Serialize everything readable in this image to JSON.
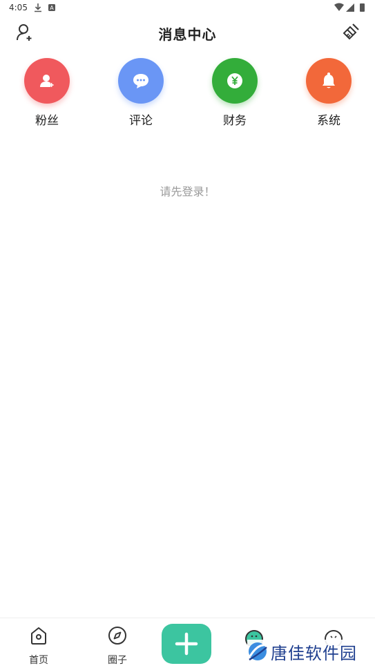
{
  "status_bar": {
    "time": "4:05"
  },
  "header": {
    "title": "消息中心"
  },
  "categories": [
    {
      "label": "粉丝",
      "color": "#f0595d",
      "icon": "fans-icon"
    },
    {
      "label": "评论",
      "color": "#6a96f5",
      "icon": "comment-icon"
    },
    {
      "label": "财务",
      "color": "#33ad3a",
      "icon": "finance-icon"
    },
    {
      "label": "系统",
      "color": "#f2683a",
      "icon": "bell-icon"
    }
  ],
  "empty_state": {
    "message": "请先登录！"
  },
  "bottom_nav": {
    "items": [
      {
        "label": "首页",
        "icon": "home-icon"
      },
      {
        "label": "圈子",
        "icon": "compass-icon"
      },
      {
        "label": "",
        "icon": "message-icon"
      },
      {
        "label": "",
        "icon": "profile-icon"
      }
    ],
    "fab_color": "#3cc5a0"
  },
  "watermark": {
    "text": "唐佳软件园"
  }
}
